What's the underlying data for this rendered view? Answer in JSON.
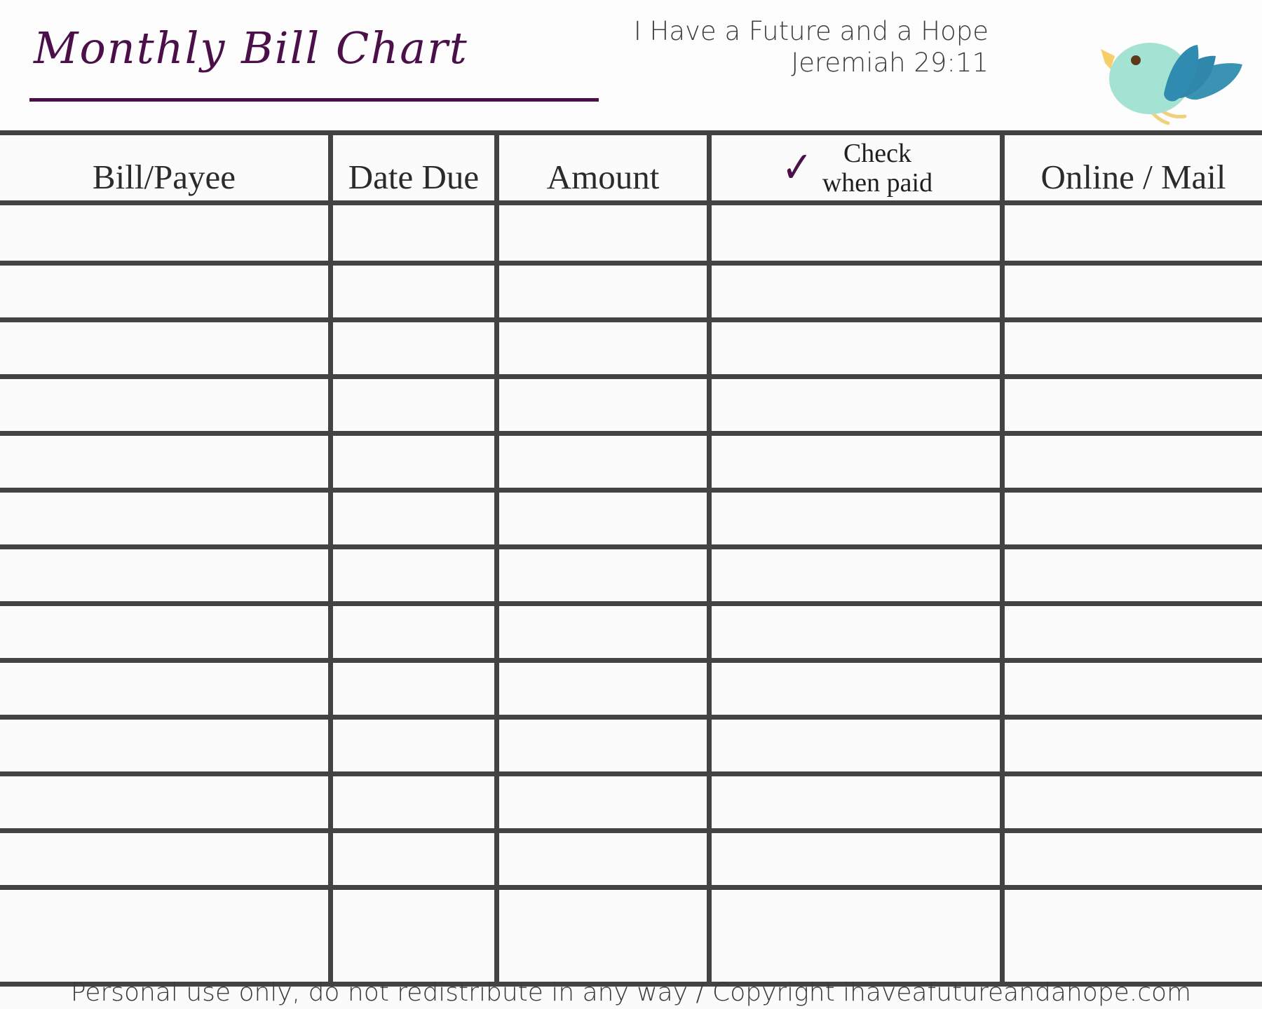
{
  "header": {
    "title": "Monthly Bill Chart",
    "tagline_line1": "I Have a Future and a Hope",
    "tagline_line2": "Jeremiah 29:11",
    "logo_icon": "bird-icon"
  },
  "table": {
    "columns": [
      {
        "id": "bill-payee",
        "label": "Bill/Payee"
      },
      {
        "id": "date-due",
        "label": "Date Due"
      },
      {
        "id": "amount",
        "label": "Amount"
      },
      {
        "id": "check-paid",
        "label_line1": "Check",
        "label_line2": "when paid",
        "icon": "checkmark-icon",
        "icon_glyph": "✓"
      },
      {
        "id": "online-mail",
        "label": "Online / Mail"
      }
    ],
    "row_count": 13,
    "rows": [
      {
        "bill_payee": "",
        "date_due": "",
        "amount": "",
        "check_paid": "",
        "online_mail": ""
      },
      {
        "bill_payee": "",
        "date_due": "",
        "amount": "",
        "check_paid": "",
        "online_mail": ""
      },
      {
        "bill_payee": "",
        "date_due": "",
        "amount": "",
        "check_paid": "",
        "online_mail": ""
      },
      {
        "bill_payee": "",
        "date_due": "",
        "amount": "",
        "check_paid": "",
        "online_mail": ""
      },
      {
        "bill_payee": "",
        "date_due": "",
        "amount": "",
        "check_paid": "",
        "online_mail": ""
      },
      {
        "bill_payee": "",
        "date_due": "",
        "amount": "",
        "check_paid": "",
        "online_mail": ""
      },
      {
        "bill_payee": "",
        "date_due": "",
        "amount": "",
        "check_paid": "",
        "online_mail": ""
      },
      {
        "bill_payee": "",
        "date_due": "",
        "amount": "",
        "check_paid": "",
        "online_mail": ""
      },
      {
        "bill_payee": "",
        "date_due": "",
        "amount": "",
        "check_paid": "",
        "online_mail": ""
      },
      {
        "bill_payee": "",
        "date_due": "",
        "amount": "",
        "check_paid": "",
        "online_mail": ""
      },
      {
        "bill_payee": "",
        "date_due": "",
        "amount": "",
        "check_paid": "",
        "online_mail": ""
      },
      {
        "bill_payee": "",
        "date_due": "",
        "amount": "",
        "check_paid": "",
        "online_mail": ""
      },
      {
        "bill_payee": "",
        "date_due": "",
        "amount": "",
        "check_paid": "",
        "online_mail": ""
      }
    ]
  },
  "footer": {
    "note": "Personal use only, do not redistribute in any way / Copyright ihaveafutureandahope.com"
  },
  "colors": {
    "title_purple": "#4b104a",
    "rule_gray": "#434343",
    "text_dark": "#2b2b2b",
    "page_background": "#fbfbfb",
    "bird_body": "#9fe0d3",
    "bird_wing_front": "#2f8cb0",
    "bird_wing_back": "#3a8fad",
    "bird_beak": "#f6cf6a",
    "bird_eye": "#5a3a18"
  }
}
